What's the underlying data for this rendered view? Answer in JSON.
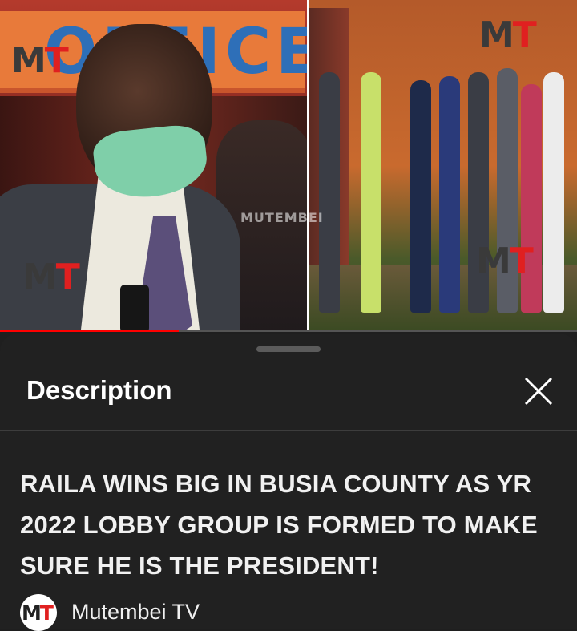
{
  "video": {
    "sign_text": "OFFICE",
    "logo_m": "M",
    "logo_t": "T",
    "watermark": "MUTEMBEI",
    "progress_percent": 31
  },
  "sheet": {
    "title": "Description",
    "close_icon": "close-icon",
    "video_title": "RAILA WINS BIG IN BUSIA COUNTY AS YR 2022 LOBBY GROUP IS FORMED TO MAKE SURE HE IS THE PRESIDENT!",
    "channel": {
      "avatar_m": "M",
      "avatar_t": "T",
      "name": "Mutembei TV"
    }
  },
  "colors": {
    "brand_red": "#e02020",
    "progress": "#ff0000",
    "sheet_bg": "#212121"
  }
}
